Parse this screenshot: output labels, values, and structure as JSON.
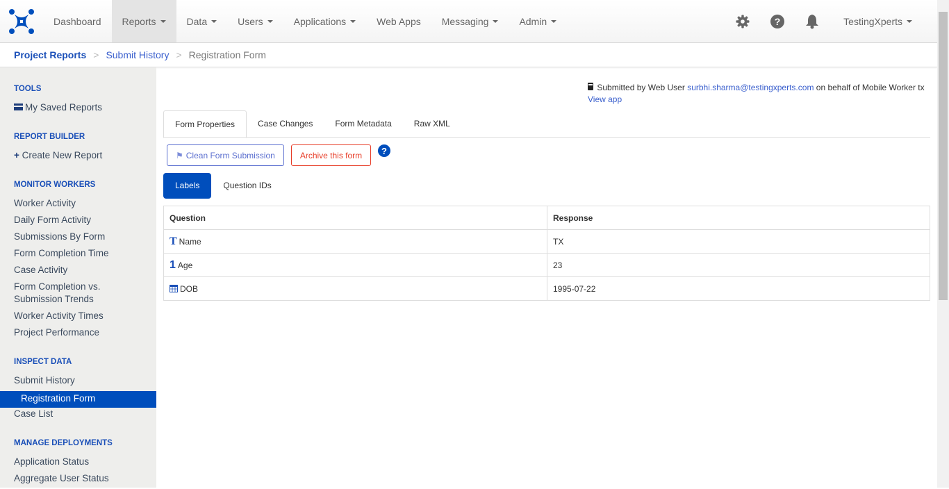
{
  "nav": {
    "items": [
      {
        "label": "Dashboard",
        "dropdown": false
      },
      {
        "label": "Reports",
        "dropdown": true
      },
      {
        "label": "Data",
        "dropdown": true
      },
      {
        "label": "Users",
        "dropdown": true
      },
      {
        "label": "Applications",
        "dropdown": true
      },
      {
        "label": "Web Apps",
        "dropdown": false
      },
      {
        "label": "Messaging",
        "dropdown": true
      },
      {
        "label": "Admin",
        "dropdown": true
      }
    ],
    "active": "Reports",
    "user": "TestingXperts"
  },
  "breadcrumb": [
    "Project Reports",
    "Submit History",
    "Registration Form"
  ],
  "sidebar": {
    "sections": [
      {
        "title": "TOOLS",
        "items": [
          "My Saved Reports"
        ]
      },
      {
        "title": "REPORT BUILDER",
        "items": [
          "Create New Report"
        ]
      },
      {
        "title": "MONITOR WORKERS",
        "items": [
          "Worker Activity",
          "Daily Form Activity",
          "Submissions By Form",
          "Form Completion Time",
          "Case Activity",
          "Form Completion vs. Submission Trends",
          "Worker Activity Times",
          "Project Performance"
        ]
      },
      {
        "title": "INSPECT DATA",
        "items": [
          "Submit History",
          "Registration Form",
          "Case List"
        ]
      },
      {
        "title": "MANAGE DEPLOYMENTS",
        "items": [
          "Application Status",
          "Aggregate User Status"
        ]
      }
    ],
    "active": "Registration Form"
  },
  "submitted": {
    "prefix": "Submitted by Web User",
    "email": "surbhi.sharma@testingxperts.com",
    "suffix": "on behalf of Mobile Worker tx",
    "view_app": "View app"
  },
  "tabs": [
    "Form Properties",
    "Case Changes",
    "Form Metadata",
    "Raw XML"
  ],
  "buttons": {
    "clean": "Clean Form Submission",
    "archive": "Archive this form"
  },
  "pills": [
    "Labels",
    "Question IDs"
  ],
  "table": {
    "headers": [
      "Question",
      "Response"
    ],
    "rows": [
      {
        "icon": "T",
        "question": "Name",
        "response": "TX"
      },
      {
        "icon": "1",
        "question": "Age",
        "response": "23"
      },
      {
        "icon": "calendar",
        "question": "DOB",
        "response": "1995-07-22"
      }
    ]
  },
  "colors": {
    "brand": "#004ebc",
    "danger": "#e73c27"
  }
}
